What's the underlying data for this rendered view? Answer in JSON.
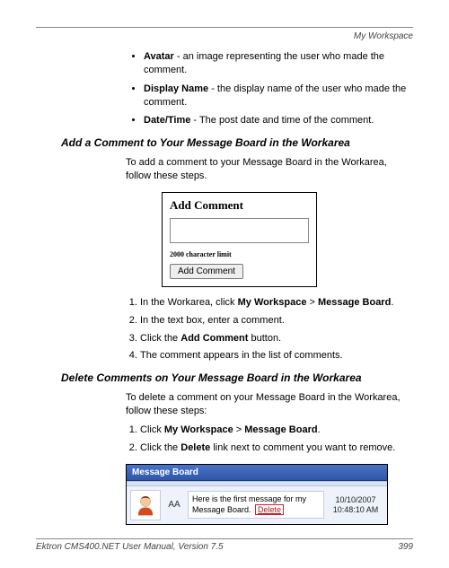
{
  "header": {
    "section": "My Workspace"
  },
  "bullets": [
    {
      "term": "Avatar",
      "desc": " - an image representing the user who made the comment."
    },
    {
      "term": "Display Name",
      "desc": " - the display name of the user who made the comment."
    },
    {
      "term": "Date/Time",
      "desc": " - The post date and time of the comment."
    }
  ],
  "section1": {
    "heading": "Add a Comment to Your Message Board in the Workarea",
    "intro": "To add a comment to your Message Board in the Workarea, follow these steps.",
    "figure": {
      "title": "Add Comment",
      "char_limit": "2000 character limit",
      "button": "Add Comment"
    },
    "steps": [
      {
        "pre": "In the Workarea, click ",
        "b1": "My Workspace",
        "mid": " > ",
        "b2": "Message Board",
        "post": "."
      },
      {
        "pre": "In the text box, enter a comment."
      },
      {
        "pre": "Click the ",
        "b1": "Add Comment",
        "post": " button."
      },
      {
        "pre": "The comment appears in the list of comments."
      }
    ]
  },
  "section2": {
    "heading": "Delete Comments on Your Message Board in the Workarea",
    "intro": "To delete a comment on your Message Board in the Workarea, follow these steps:",
    "steps": [
      {
        "pre": "Click ",
        "b1": "My Workspace",
        "mid": " > ",
        "b2": "Message Board",
        "post": "."
      },
      {
        "pre": "Click the ",
        "b1": "Delete",
        "post": " link next to comment you want to remove."
      }
    ],
    "figure": {
      "header": "Message Board",
      "initials": "AA",
      "msg_pre": "Here is the first message for my Message Board. ",
      "delete_label": "Delete",
      "date": "10/10/2007",
      "time": "10:48:10 AM"
    }
  },
  "footer": {
    "manual": "Ektron CMS400.NET User Manual, Version 7.5",
    "page": "399"
  }
}
